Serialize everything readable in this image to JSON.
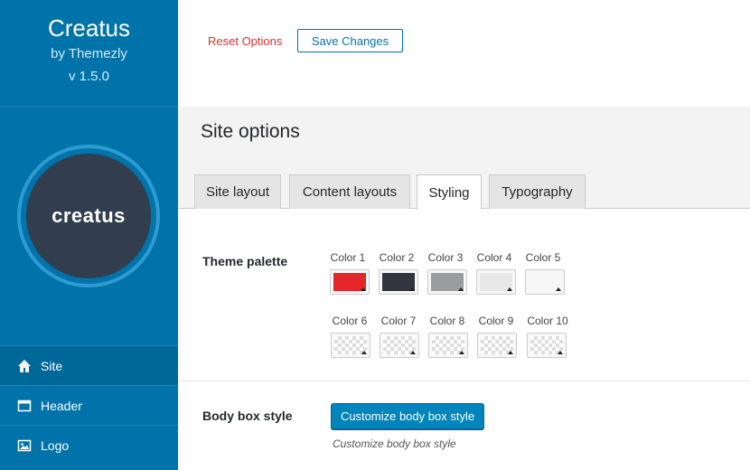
{
  "sidebar": {
    "title": "Creatus",
    "byline": "by Themezly",
    "version": "v 1.5.0",
    "logo_text": "creatus",
    "nav": [
      {
        "label": "Site",
        "icon": "home-icon",
        "active": true
      },
      {
        "label": "Header",
        "icon": "window-icon",
        "active": false
      },
      {
        "label": "Logo",
        "icon": "image-icon",
        "active": false
      }
    ]
  },
  "toolbar": {
    "reset_label": "Reset Options",
    "save_label": "Save Changes"
  },
  "section": {
    "title": "Site options",
    "tabs": [
      {
        "label": "Site layout",
        "active": false
      },
      {
        "label": "Content layouts",
        "active": false
      },
      {
        "label": "Styling",
        "active": true
      },
      {
        "label": "Typography",
        "active": false
      }
    ]
  },
  "palette": {
    "label": "Theme palette",
    "colors": [
      {
        "label": "Color 1",
        "value": "#e52629"
      },
      {
        "label": "Color 2",
        "value": "#323540"
      },
      {
        "label": "Color 3",
        "value": "#9a9ca0"
      },
      {
        "label": "Color 4",
        "value": "#e8e8e8"
      },
      {
        "label": "Color 5",
        "value": "#f6f6f6"
      },
      {
        "label": "Color 6",
        "value": ""
      },
      {
        "label": "Color 7",
        "value": ""
      },
      {
        "label": "Color 8",
        "value": ""
      },
      {
        "label": "Color 9",
        "value": ""
      },
      {
        "label": "Color 10",
        "value": ""
      }
    ]
  },
  "body_box": {
    "label": "Body box style",
    "button_label": "Customize body box style",
    "hint": "Customize body box style"
  },
  "colors": {
    "sidebar_bg": "#0073aa",
    "accent": "#0085ba",
    "danger": "#dc3232"
  }
}
